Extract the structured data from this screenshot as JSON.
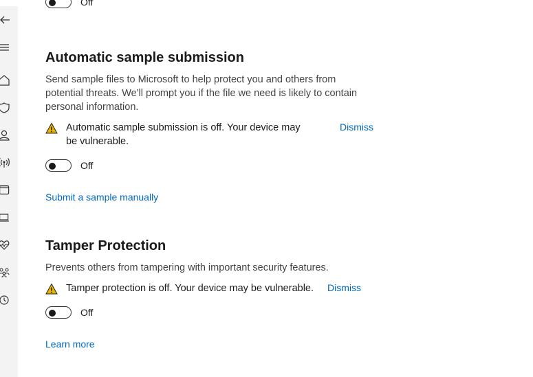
{
  "top_partial_toggle": {
    "state_label": "Off"
  },
  "sample_submission": {
    "title": "Automatic sample submission",
    "description": "Send sample files to Microsoft to help protect you and others from potential threats. We'll prompt you if the file we need is likely to contain personal information.",
    "warning": "Automatic sample submission is off. Your device may be vulnerable.",
    "dismiss_label": "Dismiss",
    "toggle_label": "Off",
    "toggle_on": false,
    "manual_link": "Submit a sample manually"
  },
  "tamper_protection": {
    "title": "Tamper Protection",
    "description": "Prevents others from tampering with important security features.",
    "warning": "Tamper protection is off. Your device may be vulnerable.",
    "dismiss_label": "Dismiss",
    "toggle_label": "Off",
    "toggle_on": false,
    "learn_more": "Learn more"
  },
  "nav": {
    "items": [
      {
        "icon": "back-arrow-icon"
      },
      {
        "icon": "hamburger-menu-icon"
      },
      {
        "icon": "home-icon"
      },
      {
        "icon": "shield-icon"
      },
      {
        "icon": "person-icon"
      },
      {
        "icon": "wireless-icon"
      },
      {
        "icon": "app-browser-icon"
      },
      {
        "icon": "laptop-icon"
      },
      {
        "icon": "heart-pulse-icon"
      },
      {
        "icon": "family-icon"
      },
      {
        "icon": "history-icon"
      }
    ]
  },
  "colors": {
    "accent": "#0067c0",
    "warning": "#e8b400",
    "rail": "#f3f3f3"
  }
}
